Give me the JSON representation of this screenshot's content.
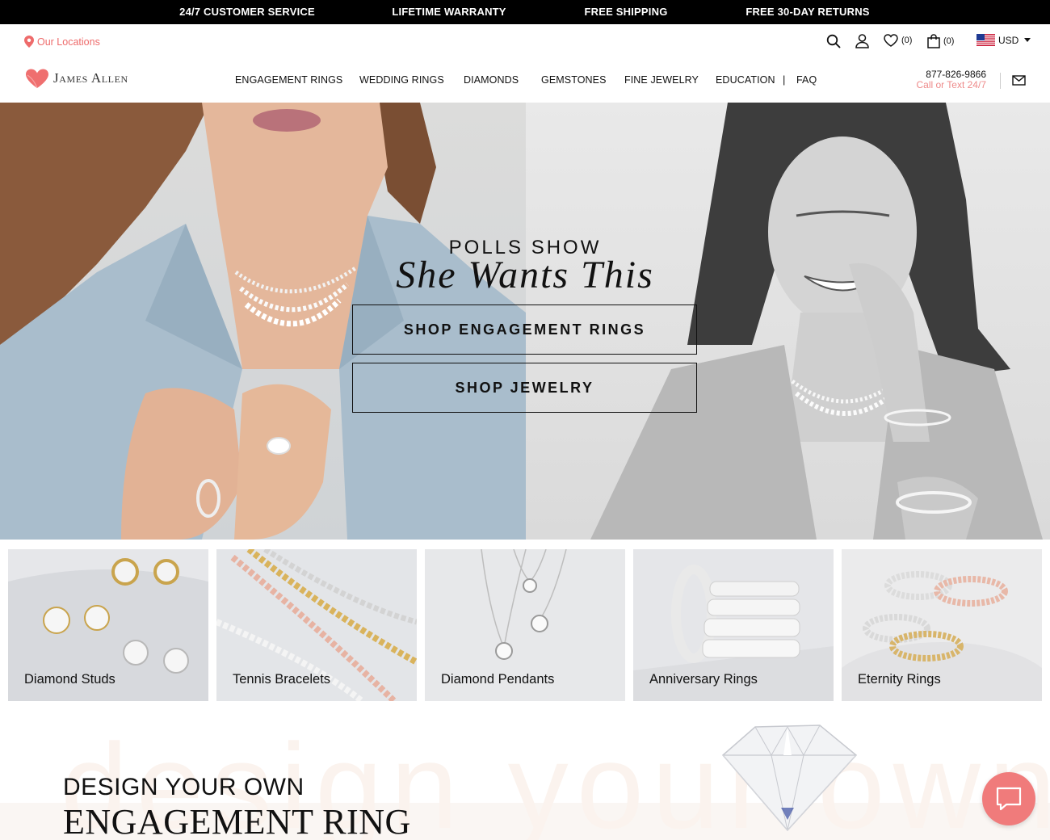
{
  "promo_bar": [
    "24/7 CUSTOMER SERVICE",
    "LIFETIME WARRANTY",
    "FREE SHIPPING",
    "FREE 30-DAY RETURNS"
  ],
  "utility": {
    "locations_label": "Our Locations",
    "wishlist_count": "(0)",
    "cart_count": "(0)",
    "currency": "USD",
    "icons": [
      "location-pin-icon",
      "search-icon",
      "user-icon",
      "heart-icon",
      "bag-icon",
      "us-flag-icon",
      "chevron-down-icon"
    ]
  },
  "header": {
    "logo_text": "James Allen",
    "nav": [
      "ENGAGEMENT RINGS",
      "WEDDING RINGS",
      "DIAMONDS",
      "GEMSTONES",
      "FINE JEWELRY",
      "EDUCATION",
      "FAQ"
    ],
    "nav_separator": "|",
    "phone": "877-826-9866",
    "phone_sub": "Call or Text 24/7"
  },
  "hero": {
    "kicker": "POLLS SHOW",
    "headline": "She Wants This",
    "buttons": [
      "SHOP ENGAGEMENT RINGS",
      "SHOP JEWELRY"
    ]
  },
  "categories": [
    "Diamond Studs",
    "Tennis Bracelets",
    "Diamond Pendants",
    "Anniversary Rings",
    "Eternity Rings"
  ],
  "design": {
    "watermark": "design your own",
    "line1": "DESIGN YOUR OWN",
    "line2": "ENGAGEMENT RING"
  },
  "colors": {
    "accent": "#ee6b6b",
    "promo_bg": "#000000",
    "chat_bg": "#f07b7b"
  }
}
